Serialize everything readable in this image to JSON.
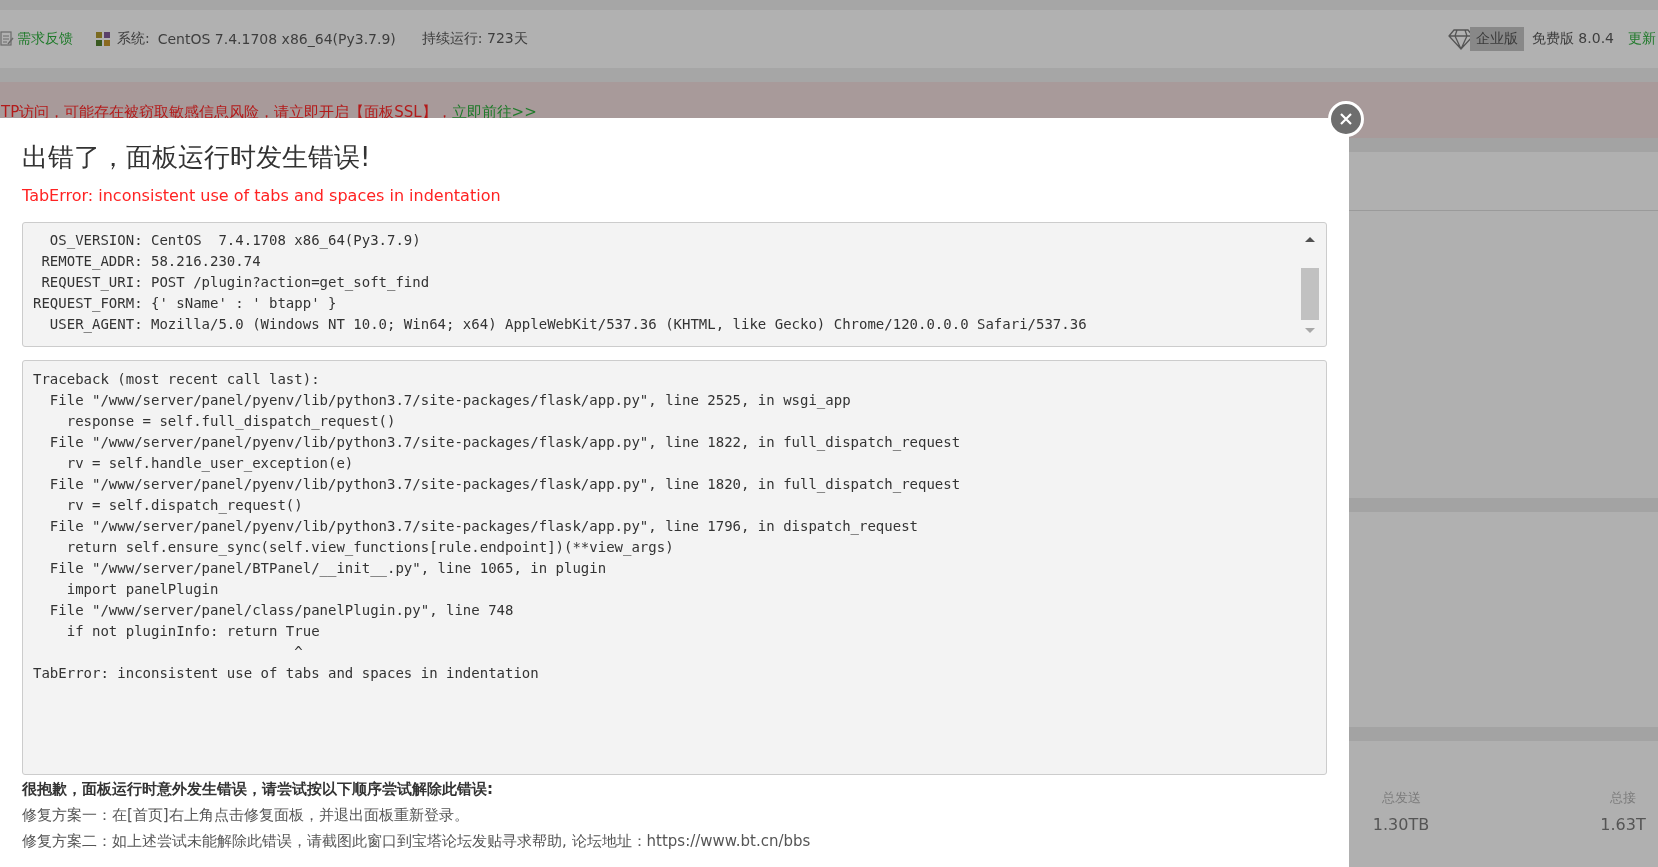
{
  "header": {
    "feedback": "需求反馈",
    "system_label": "系统:",
    "system": "CentOS 7.4.1708 x86_64(Py3.7.9)",
    "uptime": "持续运行: 723天",
    "edition_badge": "企业版",
    "version": "免费版 8.0.4",
    "update_link": "更新"
  },
  "banner": {
    "warning": "TP访问，可能存在被窃取敏感信息风险，请立即开启【面板SSL】，",
    "link": "立即前往>>"
  },
  "dialog": {
    "title": "出错了，面板运行时发生错误!",
    "error": "TabError: inconsistent use of tabs and spaces in indentation",
    "environment_lines": [
      "  OS_VERSION: CentOS  7.4.1708 x86_64(Py3.7.9)",
      " REMOTE_ADDR: 58.216.230.74",
      " REQUEST_URI: POST /plugin?action=get_soft_find",
      "REQUEST_FORM: {' sName' : ' btapp' }",
      "  USER_AGENT: Mozilla/5.0 (Windows NT 10.0; Win64; x64) AppleWebKit/537.36 (KHTML, like Gecko) Chrome/120.0.0.0 Safari/537.36"
    ],
    "traceback_lines": [
      "Traceback (most recent call last):",
      "  File \"/www/server/panel/pyenv/lib/python3.7/site-packages/flask/app.py\", line 2525, in wsgi_app",
      "    response = self.full_dispatch_request()",
      "  File \"/www/server/panel/pyenv/lib/python3.7/site-packages/flask/app.py\", line 1822, in full_dispatch_request",
      "    rv = self.handle_user_exception(e)",
      "  File \"/www/server/panel/pyenv/lib/python3.7/site-packages/flask/app.py\", line 1820, in full_dispatch_request",
      "    rv = self.dispatch_request()",
      "  File \"/www/server/panel/pyenv/lib/python3.7/site-packages/flask/app.py\", line 1796, in dispatch_request",
      "    return self.ensure_sync(self.view_functions[rule.endpoint])(**view_args)",
      "  File \"/www/server/panel/BTPanel/__init__.py\", line 1065, in plugin",
      "    import panelPlugin",
      "  File \"/www/server/panel/class/panelPlugin.py\", line 748",
      "    if not pluginInfo: return True",
      "                               ^",
      "TabError: inconsistent use of tabs and spaces in indentation"
    ],
    "help": {
      "heading": "很抱歉，面板运行时意外发生错误，请尝试按以下顺序尝试解除此错误:",
      "steps": [
        "修复方案一：在[首页]右上角点击修复面板，并退出面板重新登录。",
        "修复方案二：如上述尝试未能解除此错误，请截图此窗口到宝塔论坛发贴寻求帮助, 论坛地址：https://www.bt.cn/bbs"
      ]
    }
  },
  "stats": [
    {
      "label": "总发送",
      "value": "1.30TB"
    },
    {
      "label": "总接",
      "value": "1.63T"
    }
  ]
}
